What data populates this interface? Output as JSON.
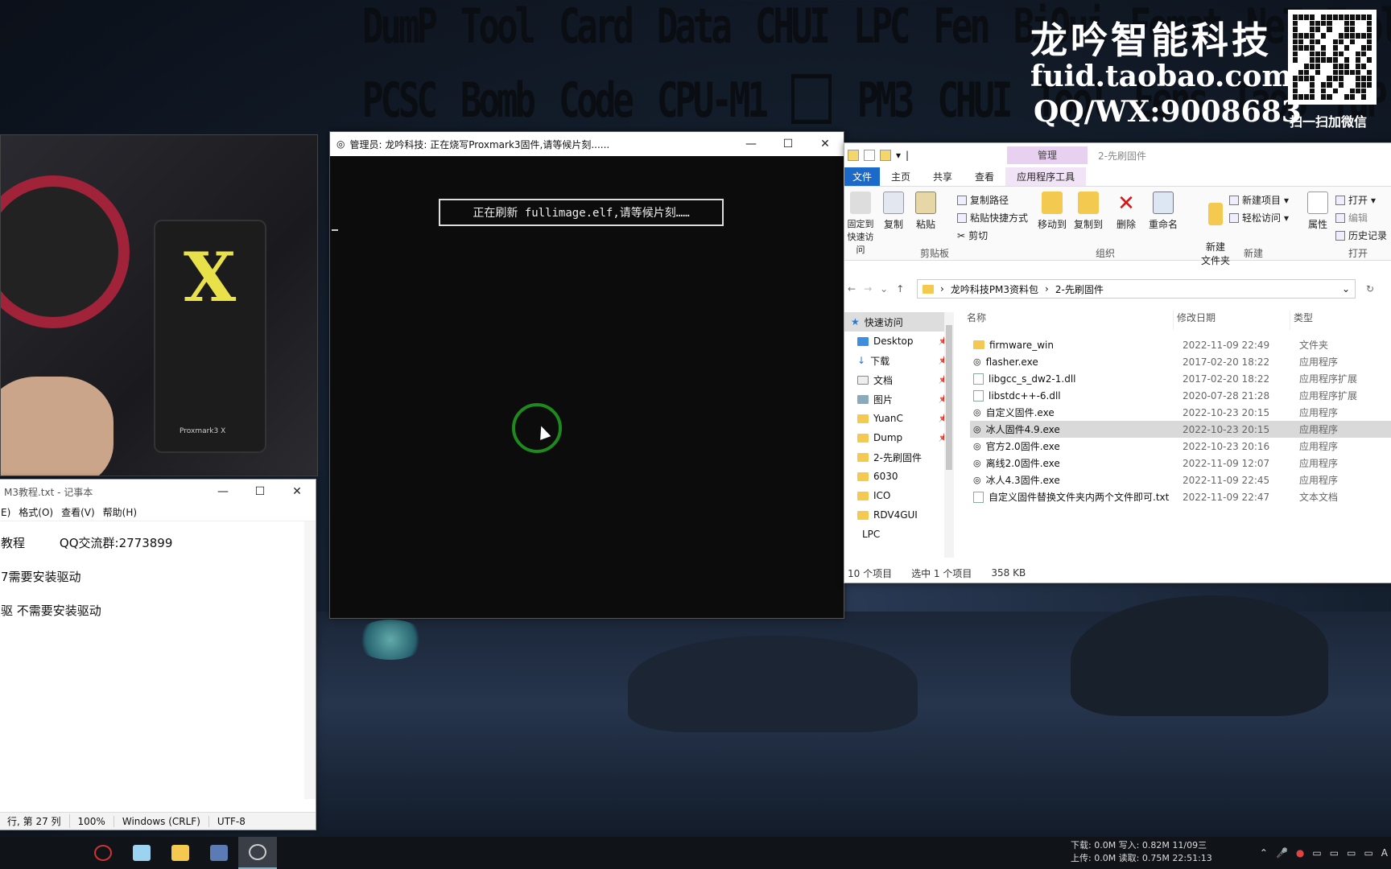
{
  "wallpaper": {
    "banner_row1": [
      "DumP",
      "Tool",
      "Card",
      "Data",
      "CHUI",
      "LPC",
      "Fen",
      "BiOui",
      "Fomat",
      "NeT",
      "Tool"
    ],
    "banner_row2": [
      "PCSC",
      "Bomb",
      "Code",
      "CPU-M1",
      "",
      "PM3",
      "CHUI",
      "Tool",
      "Eens",
      "TaoB",
      "TuP"
    ],
    "brand_title": "龙吟智能科技",
    "brand_url": "fuid.taobao.com",
    "brand_qq": "QQ/WX:9008683",
    "qr_caption": "扫一扫加微信"
  },
  "webcam": {
    "device_letter": "X",
    "device_label": "Proxmark3 X"
  },
  "console": {
    "title": "管理员:  龙吟科技: 正在烧写Proxmark3固件,请等候片刻......",
    "message": "正在刷新 fullimage.elf,请等候片刻……"
  },
  "explorer": {
    "qat_separator": "|",
    "context_tab": "管理",
    "window_title": "2-先刷固件",
    "tabs": [
      "文件",
      "主页",
      "共享",
      "查看",
      "应用程序工具"
    ],
    "ribbon": {
      "pin_label": "固定到快速访问",
      "copy": "复制",
      "paste": "粘贴",
      "copy_path": "复制路径",
      "paste_shortcut": "粘贴快捷方式",
      "cut": "剪切",
      "clipboard_group": "剪贴板",
      "move_to": "移动到",
      "copy_to": "复制到",
      "delete": "删除",
      "rename": "重命名",
      "organize_group": "组织",
      "new_folder": "新建\n文件夹",
      "new_item": "新建项目",
      "easy_access": "轻松访问",
      "new_group": "新建",
      "properties": "属性",
      "open": "打开",
      "edit": "编辑",
      "history": "历史记录",
      "open_group": "打开"
    },
    "breadcrumb": [
      "龙吟科技PM3资料包",
      "2-先刷固件"
    ],
    "nav": [
      {
        "label": "快速访问",
        "pinned": false,
        "active": true
      },
      {
        "label": "Desktop",
        "pinned": true
      },
      {
        "label": "下载",
        "pinned": true
      },
      {
        "label": "文档",
        "pinned": true
      },
      {
        "label": "图片",
        "pinned": true
      },
      {
        "label": "YuanC",
        "pinned": true
      },
      {
        "label": "Dump",
        "pinned": true
      },
      {
        "label": "2-先刷固件",
        "pinned": false
      },
      {
        "label": "6030",
        "pinned": false
      },
      {
        "label": "ICO",
        "pinned": false
      },
      {
        "label": "RDV4GUI",
        "pinned": false
      },
      {
        "label": "LPC",
        "pinned": false
      }
    ],
    "columns": {
      "name": "名称",
      "date": "修改日期",
      "type": "类型"
    },
    "files": [
      {
        "name": "firmware_win",
        "date": "2022-11-09 22:49",
        "type": "文件夹",
        "kind": "folder"
      },
      {
        "name": "flasher.exe",
        "date": "2017-02-20 18:22",
        "type": "应用程序",
        "kind": "exe"
      },
      {
        "name": "libgcc_s_dw2-1.dll",
        "date": "2017-02-20 18:22",
        "type": "应用程序扩展",
        "kind": "dll"
      },
      {
        "name": "libstdc++-6.dll",
        "date": "2020-07-28 21:28",
        "type": "应用程序扩展",
        "kind": "dll"
      },
      {
        "name": "自定义固件.exe",
        "date": "2022-10-23 20:15",
        "type": "应用程序",
        "kind": "exe"
      },
      {
        "name": "冰人固件4.9.exe",
        "date": "2022-10-23 20:15",
        "type": "应用程序",
        "kind": "exe",
        "selected": true
      },
      {
        "name": "官方2.0固件.exe",
        "date": "2022-10-23 20:16",
        "type": "应用程序",
        "kind": "exe"
      },
      {
        "name": "离线2.0固件.exe",
        "date": "2022-11-09 12:07",
        "type": "应用程序",
        "kind": "exe"
      },
      {
        "name": "冰人4.3固件.exe",
        "date": "2022-11-09 22:45",
        "type": "应用程序",
        "kind": "exe"
      },
      {
        "name": "自定义固件替换文件夹内两个文件即可.txt",
        "date": "2022-11-09 22:47",
        "type": "文本文档",
        "kind": "txt"
      }
    ],
    "status": {
      "count": "10 个项目",
      "selected": "选中 1 个项目",
      "size": "358 KB"
    }
  },
  "notepad": {
    "title": "M3教程.txt - 记事本",
    "menu": [
      "E)",
      "格式(O)",
      "查看(V)",
      "帮助(H)"
    ],
    "lines": [
      "教程         QQ交流群:2773899",
      "7需要安装驱动",
      "驱 不需要安装驱动"
    ],
    "status": [
      "行, 第 27 列",
      "100%",
      "Windows (CRLF)",
      "UTF-8"
    ]
  },
  "taskbar": {
    "net_line1": "下载:  0.0M  写入: 0.82M  11/09三",
    "net_line2": "上传:  0.0M  读取: 0.75M  22:51:13",
    "tray_letter": "A"
  }
}
